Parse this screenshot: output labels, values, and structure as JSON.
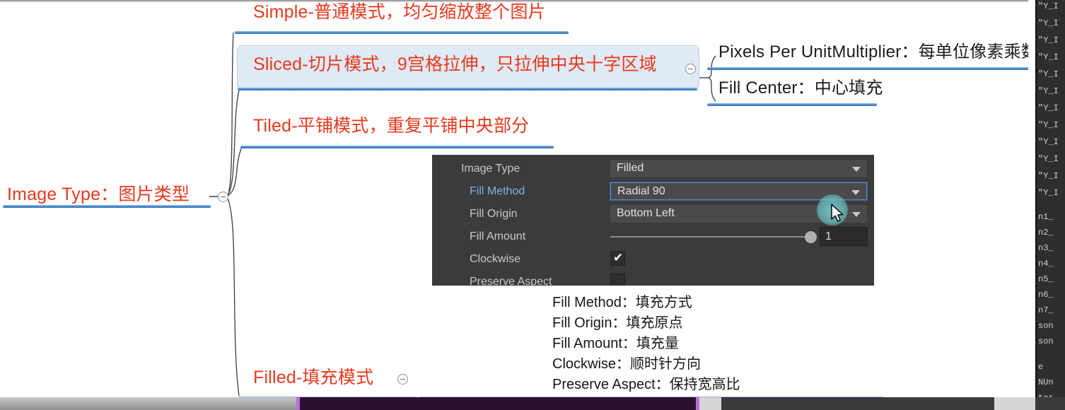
{
  "app": {
    "kind": "mindmap-annotated-screenshot"
  },
  "mindmap": {
    "root": {
      "label": "Image Type：图片类型",
      "handle_name": "collapse-handle-root"
    },
    "branches": [
      {
        "id": "simple",
        "label": "Simple-普通模式，均匀缩放整个图片",
        "selected": false
      },
      {
        "id": "sliced",
        "label": "Sliced-切片模式，9宫格拉伸，只拉伸中央十字区域",
        "selected": true
      },
      {
        "id": "tiled",
        "label": "Tiled-平铺模式，重复平铺中央部分",
        "selected": false
      },
      {
        "id": "filled",
        "label": "Filled-填充模式",
        "selected": false
      }
    ],
    "sliced_children": [
      {
        "id": "ppum",
        "label": "Pixels Per UnitMultiplier：每单位像素乘数"
      },
      {
        "id": "fillcenter",
        "label": "Fill Center：中心填充"
      }
    ],
    "colors": {
      "topic_text": "#e8391d",
      "topic_text_dark": "#1c1c1c",
      "underline": "#4f8fd0",
      "selection_fill": "#dfeaf5",
      "selection_border": "#b9cfe4"
    }
  },
  "legend": {
    "lines": [
      "Fill Method：填充方式",
      "Fill Origin：填充原点",
      "Fill Amount：填充量",
      "Clockwise：顺时针方向",
      "Preserve Aspect：保持宽高比"
    ]
  },
  "inspector": {
    "rows": [
      {
        "label": "Image Type",
        "indent": 0,
        "accent": false,
        "control": "dropdown",
        "value": "Filled",
        "focused": false
      },
      {
        "label": "Fill Method",
        "indent": 1,
        "accent": true,
        "control": "dropdown",
        "value": "Radial 90",
        "focused": true
      },
      {
        "label": "Fill Origin",
        "indent": 1,
        "accent": false,
        "control": "dropdown",
        "value": "Bottom Left",
        "focused": false
      },
      {
        "label": "Fill Amount",
        "indent": 1,
        "accent": false,
        "control": "slider",
        "value": "1",
        "focused": false
      },
      {
        "label": "Clockwise",
        "indent": 1,
        "accent": false,
        "control": "checkbox",
        "value": "checked",
        "focused": false
      },
      {
        "label": "Preserve Aspect",
        "indent": 1,
        "accent": false,
        "control": "checkbox",
        "value": "unchecked",
        "focused": false
      }
    ],
    "colors": {
      "panel_bg": "#3b3b3b",
      "field_bg": "#4a4a4a",
      "focus_border": "#4f8bd4",
      "label": "#c8c8c8",
      "label_accent": "#7fb2e5"
    }
  },
  "cursor": {
    "name": "mouse-pointer",
    "highlight_color": "#6cc6ca"
  },
  "right_panel": {
    "lines_top": [
      "\"Y_I",
      "\"Y_I",
      "\"Y_I",
      "\"Y_I",
      "\"Y_I",
      "\"Y_I",
      "\"Y_I",
      "\"Y_I",
      "\"Y_I",
      "\"Y_I",
      "\"Y_I",
      "\"Y_I"
    ],
    "lines_bottom": [
      "n1_",
      "n2_",
      "n3_",
      "n4_",
      "n5_",
      "n6_",
      "n7_",
      "son",
      "son",
      "",
      "e",
      "NUn",
      "tor"
    ]
  }
}
